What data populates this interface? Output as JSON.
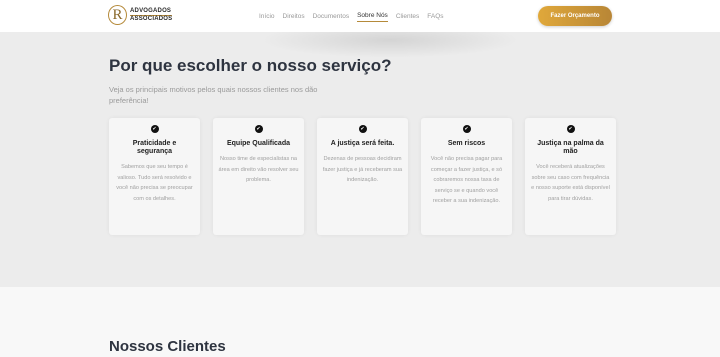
{
  "header": {
    "logo": {
      "mark": "R",
      "line1": "ADVOGADOS",
      "line2": "ASSOCIADOS"
    },
    "nav": [
      {
        "label": "Início",
        "active": false
      },
      {
        "label": "Direitos",
        "active": false
      },
      {
        "label": "Documentos",
        "active": false
      },
      {
        "label": "Sobre Nós",
        "active": true
      },
      {
        "label": "Clientes",
        "active": false
      },
      {
        "label": "FAQs",
        "active": false
      }
    ],
    "cta_label": "Fazer Orçamento"
  },
  "why": {
    "title": "Por que escolher o nosso serviço?",
    "subtitle": "Veja os principais motivos pelos quais nossos clientes nos dão preferência!",
    "cards": [
      {
        "icon": "check-icon",
        "title": "Praticidade e segurança",
        "text": "Sabemos que seu tempo é valioso. Tudo será resolvido e você não precisa se preocupar com os detalhes."
      },
      {
        "icon": "check-icon",
        "title": "Equipe Qualificada",
        "text": "Nosso time de especialistas na área em direito vão resolver seu problema."
      },
      {
        "icon": "check-icon",
        "title": "A justiça será feita.",
        "text": "Dezenas de pessoas decidiram fazer justiça e já receberam sua indenização."
      },
      {
        "icon": "check-icon",
        "title": "Sem riscos",
        "text": "Você não precisa pagar para começar a fazer justiça, e só cobraremos nossa taxa de serviço se e quando você receber a sua indenização."
      },
      {
        "icon": "check-icon",
        "title": "Justiça na palma da mão",
        "text": "Você receberá atualizações sobre seu caso com frequência e nosso suporte está disponível para tirar dúvidas."
      }
    ]
  },
  "clients": {
    "title": "Nossos Clientes"
  },
  "colors": {
    "accent": "#b58a3a",
    "cta_start": "#e0a83a",
    "cta_end": "#b88636",
    "section_bg": "#ececec"
  }
}
